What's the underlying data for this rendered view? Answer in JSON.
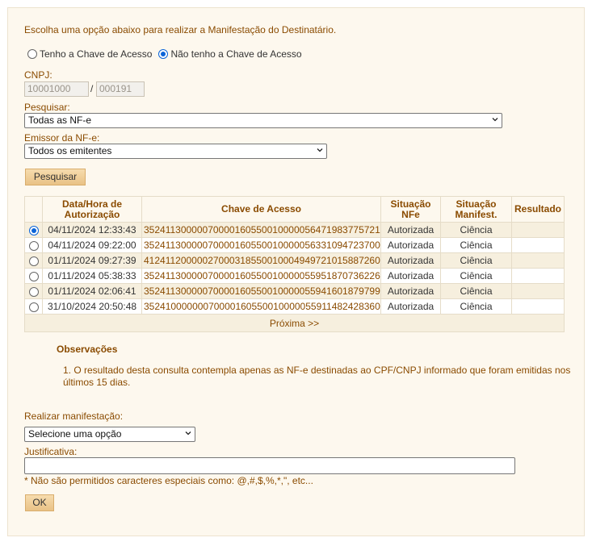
{
  "intro": "Escolha uma opção abaixo para realizar a Manifestação do Destinatário.",
  "mode": {
    "option1": "Tenho a Chave de Acesso",
    "option2": "Não tenho a Chave de Acesso",
    "selected": "option2"
  },
  "cnpj": {
    "label": "CNPJ:",
    "part1": "10001000",
    "separator": "/",
    "part2": "000191"
  },
  "pesquisar": {
    "label": "Pesquisar:",
    "value": "Todas as NF-e"
  },
  "emissor": {
    "label": "Emissor da NF-e:",
    "value": "Todos os emitentes"
  },
  "search_button": "Pesquisar",
  "table": {
    "headers": {
      "datetime": "Data/Hora de Autorização",
      "key": "Chave de Acesso",
      "status": "Situação NFe",
      "manifest": "Situação Manifest.",
      "result": "Resultado"
    },
    "rows": [
      {
        "selected": true,
        "datetime": "04/11/2024 12:33:43",
        "key": "35241130000070000160550010000056471983775721",
        "status": "Autorizada",
        "manifest": "Ciência",
        "result": ""
      },
      {
        "selected": false,
        "datetime": "04/11/2024 09:22:00",
        "key": "35241130000070000160550010000056331094723700",
        "status": "Autorizada",
        "manifest": "Ciência",
        "result": ""
      },
      {
        "selected": false,
        "datetime": "01/11/2024 09:27:39",
        "key": "41241120000027000318550010004949721015887260",
        "status": "Autorizada",
        "manifest": "Ciência",
        "result": ""
      },
      {
        "selected": false,
        "datetime": "01/11/2024 05:38:33",
        "key": "35241130000070000160550010000055951870736226",
        "status": "Autorizada",
        "manifest": "Ciência",
        "result": ""
      },
      {
        "selected": false,
        "datetime": "01/11/2024 02:06:41",
        "key": "35241130000070000160550010000055941601879799",
        "status": "Autorizada",
        "manifest": "Ciência",
        "result": ""
      },
      {
        "selected": false,
        "datetime": "31/10/2024 20:50:48",
        "key": "35241000000070000160550010000055911482428360",
        "status": "Autorizada",
        "manifest": "Ciência",
        "result": ""
      }
    ],
    "next": "Próxima >>"
  },
  "observacoes": {
    "title": "Observações",
    "item": "1. O resultado desta consulta contempla apenas as NF-e destinadas ao CPF/CNPJ informado que foram emitidas nos últimos 15 dias."
  },
  "manifestacao": {
    "label": "Realizar manifestação:",
    "value": "Selecione uma opção"
  },
  "justificativa": {
    "label": "Justificativa:",
    "value": "",
    "note": "* Não são permitidos caracteres especiais como: @,#,$,%,*,\", etc..."
  },
  "ok_button": "OK"
}
